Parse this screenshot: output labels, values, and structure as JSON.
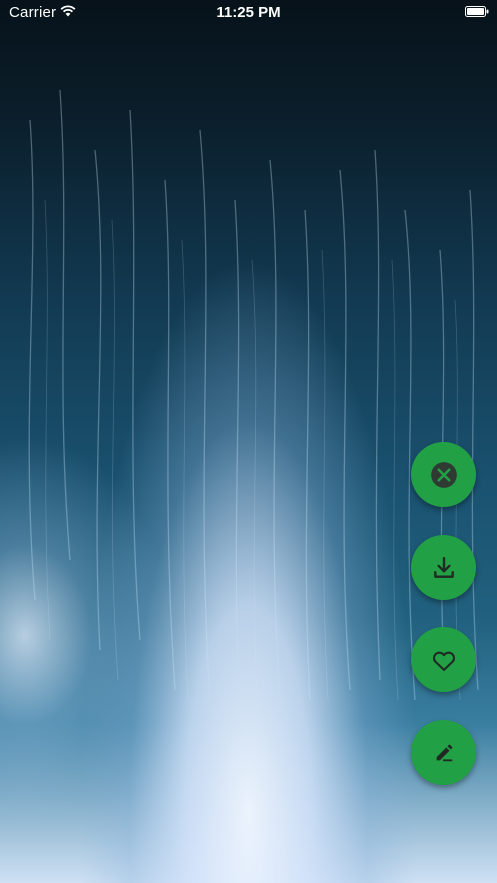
{
  "status_bar": {
    "carrier": "Carrier",
    "time": "11:25 PM",
    "wifi_icon": "wifi-icon",
    "battery_icon": "battery-icon"
  },
  "wallpaper": {
    "description_icon": "ocean-wave-wallpaper"
  },
  "actions": [
    {
      "icon": "close-circle-icon"
    },
    {
      "icon": "download-icon"
    },
    {
      "icon": "heart-outline-icon"
    },
    {
      "icon": "edit-pencil-icon"
    }
  ],
  "colors": {
    "fab_background": "#22a045",
    "fab_icon": "#1f2a22"
  }
}
